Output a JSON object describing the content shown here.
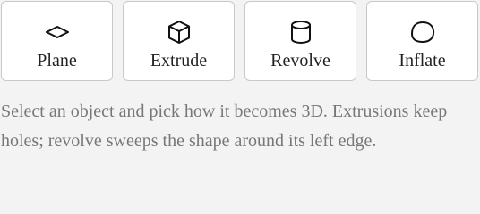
{
  "modes": [
    {
      "label": "Plane",
      "icon": "diamond-icon"
    },
    {
      "label": "Extrude",
      "icon": "cube-icon"
    },
    {
      "label": "Revolve",
      "icon": "cylinder-icon"
    },
    {
      "label": "Inflate",
      "icon": "blob-icon"
    }
  ],
  "hint": {
    "text": "Select an object and pick how it becomes 3D. Extrusions keep holes; revolve sweeps the shape around its left edge."
  },
  "colors": {
    "background": "#f3f3f3",
    "button_bg": "#ffffff",
    "button_border": "#c9c9c9",
    "label_text": "#222222",
    "hint_text": "#777777",
    "icon_stroke": "#111111"
  }
}
